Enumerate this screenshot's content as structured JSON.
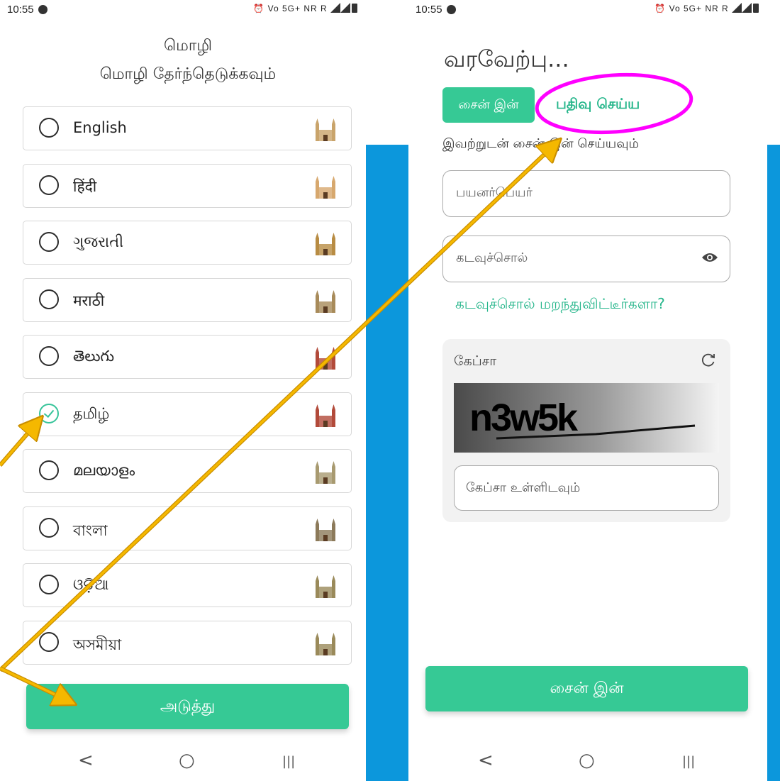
{
  "colors": {
    "accent": "#36c995",
    "link": "#26b68b",
    "background_blue": "#0c97dc",
    "annotation_arrow": "#f5b800",
    "annotation_circle": "#ff00ff"
  },
  "status_bar": {
    "time": "10:55",
    "network": "Vo 5G+ NR R"
  },
  "left_screen": {
    "title": "மொழி",
    "subtitle": "மொழி தேர்ந்தெடுக்கவும்",
    "languages": [
      {
        "label": "English",
        "selected": false,
        "icon": "tower-bridge-icon"
      },
      {
        "label": "हिंदी",
        "selected": false,
        "icon": "india-gate-icon"
      },
      {
        "label": "ગુજરાતી",
        "selected": false,
        "icon": "gujarat-monument-icon"
      },
      {
        "label": "मराठी",
        "selected": false,
        "icon": "gateway-of-india-icon"
      },
      {
        "label": "తెలుగు",
        "selected": false,
        "icon": "charminar-icon"
      },
      {
        "label": "தமிழ்",
        "selected": true,
        "icon": "chennai-central-icon"
      },
      {
        "label": "മലയാളം",
        "selected": false,
        "icon": "kerala-monument-icon"
      },
      {
        "label": "বাংলা",
        "selected": false,
        "icon": "victoria-memorial-icon"
      },
      {
        "label": "ଓଡ଼ିଆ",
        "selected": false,
        "icon": "odisha-monument-icon"
      },
      {
        "label": "অসমীয়া",
        "selected": false,
        "icon": "assam-monument-icon"
      }
    ],
    "next_button": "அடுத்து"
  },
  "right_screen": {
    "welcome": "வரவேற்பு...",
    "tab_signin": "சைன் இன்",
    "tab_register": "பதிவு செய்ய",
    "sign_in_with": "இவற்றுடன் சைன் இன் செய்யவும்",
    "username_placeholder": "பயனர்பெயர்",
    "password_placeholder": "கடவுச்சொல்",
    "forgot_password": "கடவுச்சொல் மறந்துவிட்டீர்களா?",
    "captcha_label": "கேப்சா",
    "captcha_text": "n3w5k",
    "captcha_input_placeholder": "கேப்சா உள்ளிடவும்",
    "signin_button": "சைன் இன்"
  },
  "nav_bar": {
    "back": "<",
    "home": "○",
    "recents": "|||"
  }
}
